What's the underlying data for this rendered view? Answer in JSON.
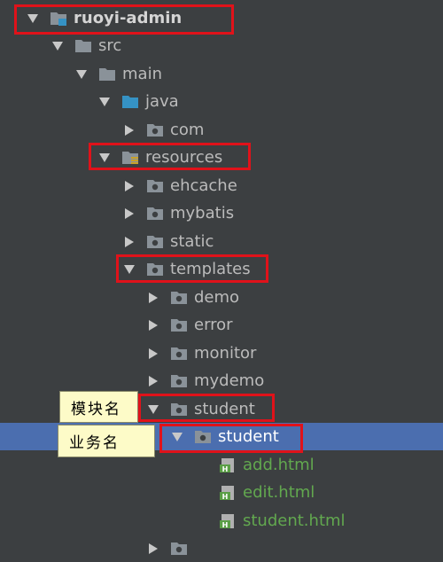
{
  "tree": {
    "root": "ruoyi-admin",
    "src": "src",
    "main": "main",
    "java": "java",
    "com": "com",
    "resources": "resources",
    "ehcache": "ehcache",
    "mybatis": "mybatis",
    "static": "static",
    "templates": "templates",
    "demo": "demo",
    "error": "error",
    "monitor": "monitor",
    "mydemo": "mydemo",
    "student_module": "student",
    "student_business": "student",
    "files": [
      "add.html",
      "edit.html",
      "student.html"
    ]
  },
  "callouts": {
    "module": "模块名",
    "business": "业务名"
  },
  "colors": {
    "background": "#3c3f41",
    "selection": "#4b6eaf",
    "highlight_box": "#e0121a",
    "callout_bg": "#fdfbc8",
    "html_file_text": "#62a84f"
  },
  "icons": {
    "expanded": "triangle-down-icon",
    "collapsed": "triangle-right-icon",
    "folder": "folder-icon",
    "package": "package-folder-icon",
    "source_root": "source-folder-icon",
    "resource_root": "resources-folder-icon",
    "module": "module-icon",
    "html_file": "html-file-icon"
  }
}
